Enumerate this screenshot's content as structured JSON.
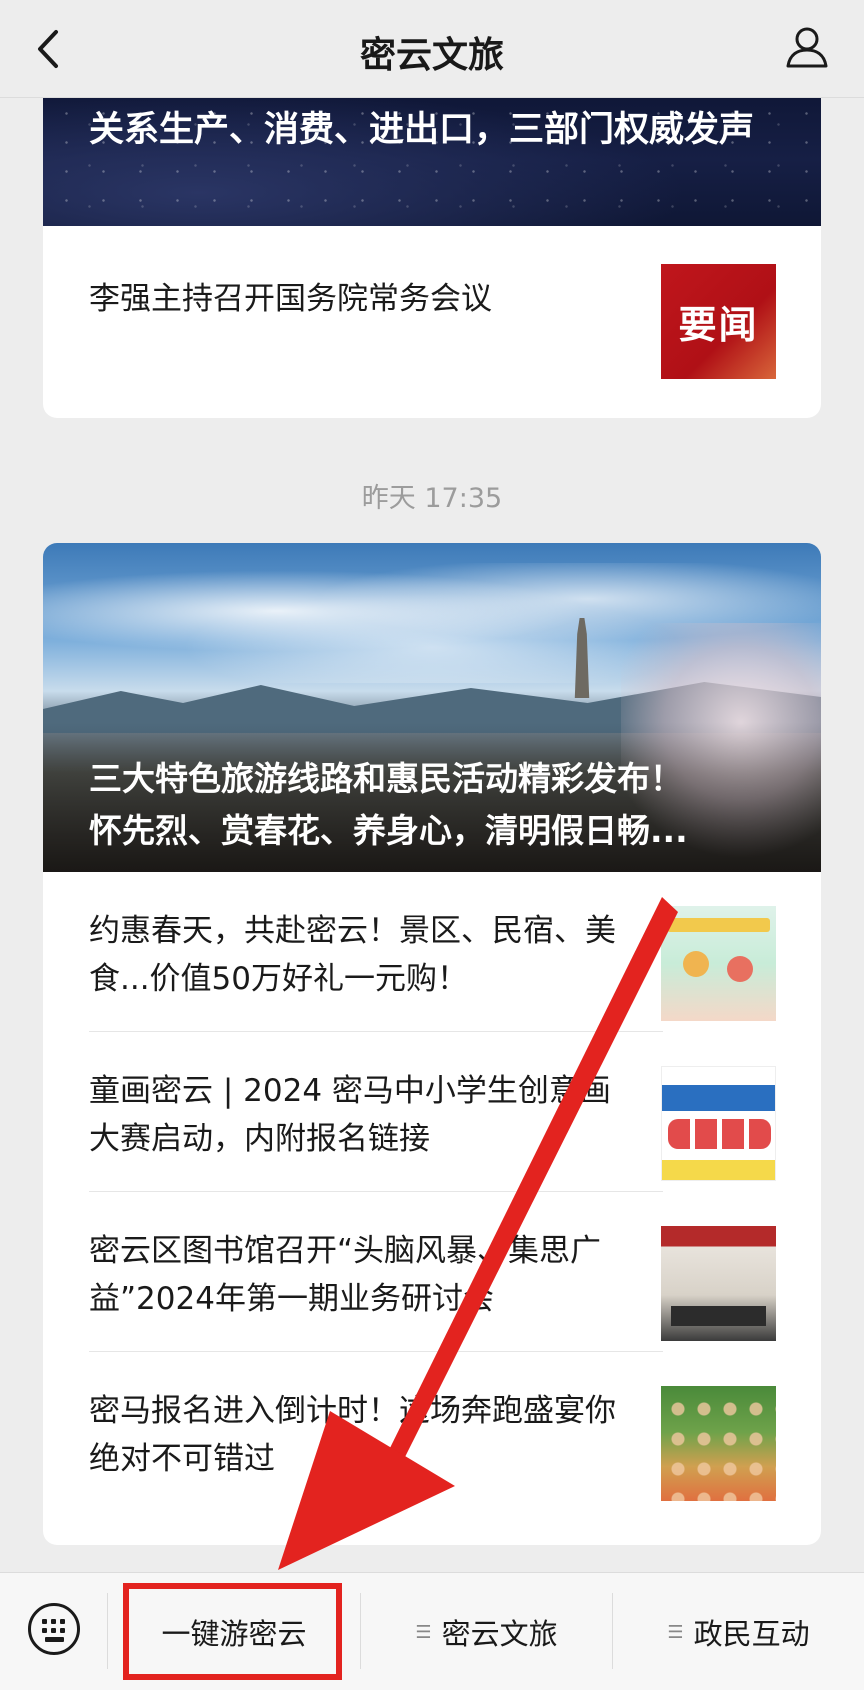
{
  "header": {
    "title": "密云文旅"
  },
  "top_card": {
    "banner_title": "关系生产、消费、进出口，三部门权威发声",
    "row_title": "李强主持召开国务院常务会议",
    "row_thumb_text": "要闻"
  },
  "timestamp": "昨天 17:35",
  "article_card": {
    "hero_title_line1": "三大特色旅游线路和惠民活动精彩发布！",
    "hero_title_line2": "怀先烈、赏春花、养身心，清明假日畅...",
    "items": [
      {
        "title": "约惠春天，共赴密云！景区、民宿、美食...价值50万好礼一元购！"
      },
      {
        "title": "童画密云 | 2024 密马中小学生创意画大赛启动，内附报名链接"
      },
      {
        "title": "密云区图书馆召开“头脑风暴、集思广益”2024年第一期业务研讨会"
      },
      {
        "title": "密马报名进入倒计时！这场奔跑盛宴你绝对不可错过"
      }
    ]
  },
  "tabbar": {
    "tabs": [
      {
        "label": "一键游密云"
      },
      {
        "label": "密云文旅"
      },
      {
        "label": "政民互动"
      }
    ]
  },
  "colors": {
    "annotation": "#e3231f",
    "background": "#ededed"
  }
}
